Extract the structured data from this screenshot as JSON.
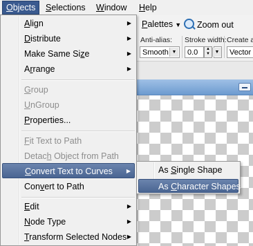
{
  "menubar": [
    {
      "pre": "",
      "key": "O",
      "post": "bjects",
      "active": true
    },
    {
      "pre": "",
      "key": "S",
      "post": "elections",
      "active": false
    },
    {
      "pre": "",
      "key": "W",
      "post": "indow",
      "active": false
    },
    {
      "pre": "",
      "key": "H",
      "post": "elp",
      "active": false
    }
  ],
  "toolbar": {
    "palettes": {
      "pre": "",
      "key": "P",
      "post": "alettes"
    },
    "zoom_out": "Zoom out",
    "anti_alias_label": "Anti-alias:",
    "anti_alias_value": "Smooth",
    "stroke_width_label": "Stroke width:",
    "stroke_width_value": "0.0",
    "create_as_label": "Create as",
    "create_as_value": "Vector"
  },
  "objects_menu": [
    {
      "pre": "",
      "key": "A",
      "post": "lign",
      "submenu": true,
      "disabled": false
    },
    {
      "pre": "",
      "key": "D",
      "post": "istribute",
      "submenu": true,
      "disabled": false
    },
    {
      "pre": "Make Same Si",
      "key": "z",
      "post": "e",
      "submenu": true,
      "disabled": false
    },
    {
      "pre": "A",
      "key": "r",
      "post": "range",
      "submenu": true,
      "disabled": false
    },
    {
      "pre": "",
      "key": "G",
      "post": "roup",
      "submenu": false,
      "disabled": true
    },
    {
      "pre": "",
      "key": "U",
      "post": "nGroup",
      "submenu": false,
      "disabled": true
    },
    {
      "pre": "",
      "key": "P",
      "post": "roperties...",
      "submenu": false,
      "disabled": false
    },
    {
      "pre": "",
      "key": "F",
      "post": "it Text to Path",
      "submenu": false,
      "disabled": true
    },
    {
      "pre": "Detac",
      "key": "h",
      "post": " Object from Path",
      "submenu": false,
      "disabled": true
    },
    {
      "pre": "",
      "key": "C",
      "post": "onvert Text to Curves",
      "submenu": true,
      "disabled": false,
      "highlight": true
    },
    {
      "pre": "Con",
      "key": "v",
      "post": "ert to Path",
      "submenu": false,
      "disabled": false
    },
    {
      "pre": "",
      "key": "E",
      "post": "dit",
      "submenu": true,
      "disabled": false
    },
    {
      "pre": "",
      "key": "N",
      "post": "ode Type",
      "submenu": true,
      "disabled": false
    },
    {
      "pre": "",
      "key": "T",
      "post": "ransform Selected Nodes",
      "submenu": true,
      "disabled": false
    }
  ],
  "convert_submenu": [
    {
      "pre": "As ",
      "key": "S",
      "post": "ingle Shape",
      "highlight": false
    },
    {
      "pre": "As ",
      "key": "C",
      "post": "haracter Shapes",
      "highlight": true
    }
  ]
}
